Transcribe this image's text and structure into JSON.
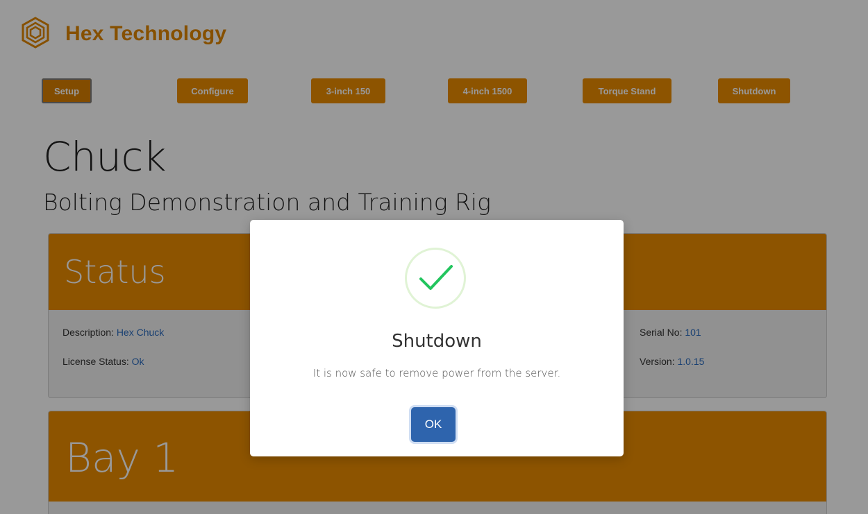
{
  "app": {
    "brand_name": "Hex Technology",
    "accent_color": "#ec8d00"
  },
  "nav": [
    {
      "label": "Setup",
      "active": true
    },
    {
      "label": "Configure"
    },
    {
      "label": "3-inch 150"
    },
    {
      "label": "4-inch 1500"
    },
    {
      "label": "Torque Stand"
    },
    {
      "label": "Shutdown"
    }
  ],
  "page": {
    "title": "Chuck",
    "subtitle": "Bolting Demonstration and Training Rig"
  },
  "status_card": {
    "heading": "Status",
    "description_label": "Description:",
    "description_value": "Hex Chuck",
    "license_label": "License Status:",
    "license_value": "Ok",
    "serial_label": "Serial No:",
    "serial_value": "101",
    "version_label": "Version:",
    "version_value": "1.0.15"
  },
  "bay_card": {
    "heading": "Bay 1"
  },
  "modal": {
    "icon": "success-check-icon",
    "title": "Shutdown",
    "message": "It is now safe to remove power from the server.",
    "ok_label": "OK"
  }
}
